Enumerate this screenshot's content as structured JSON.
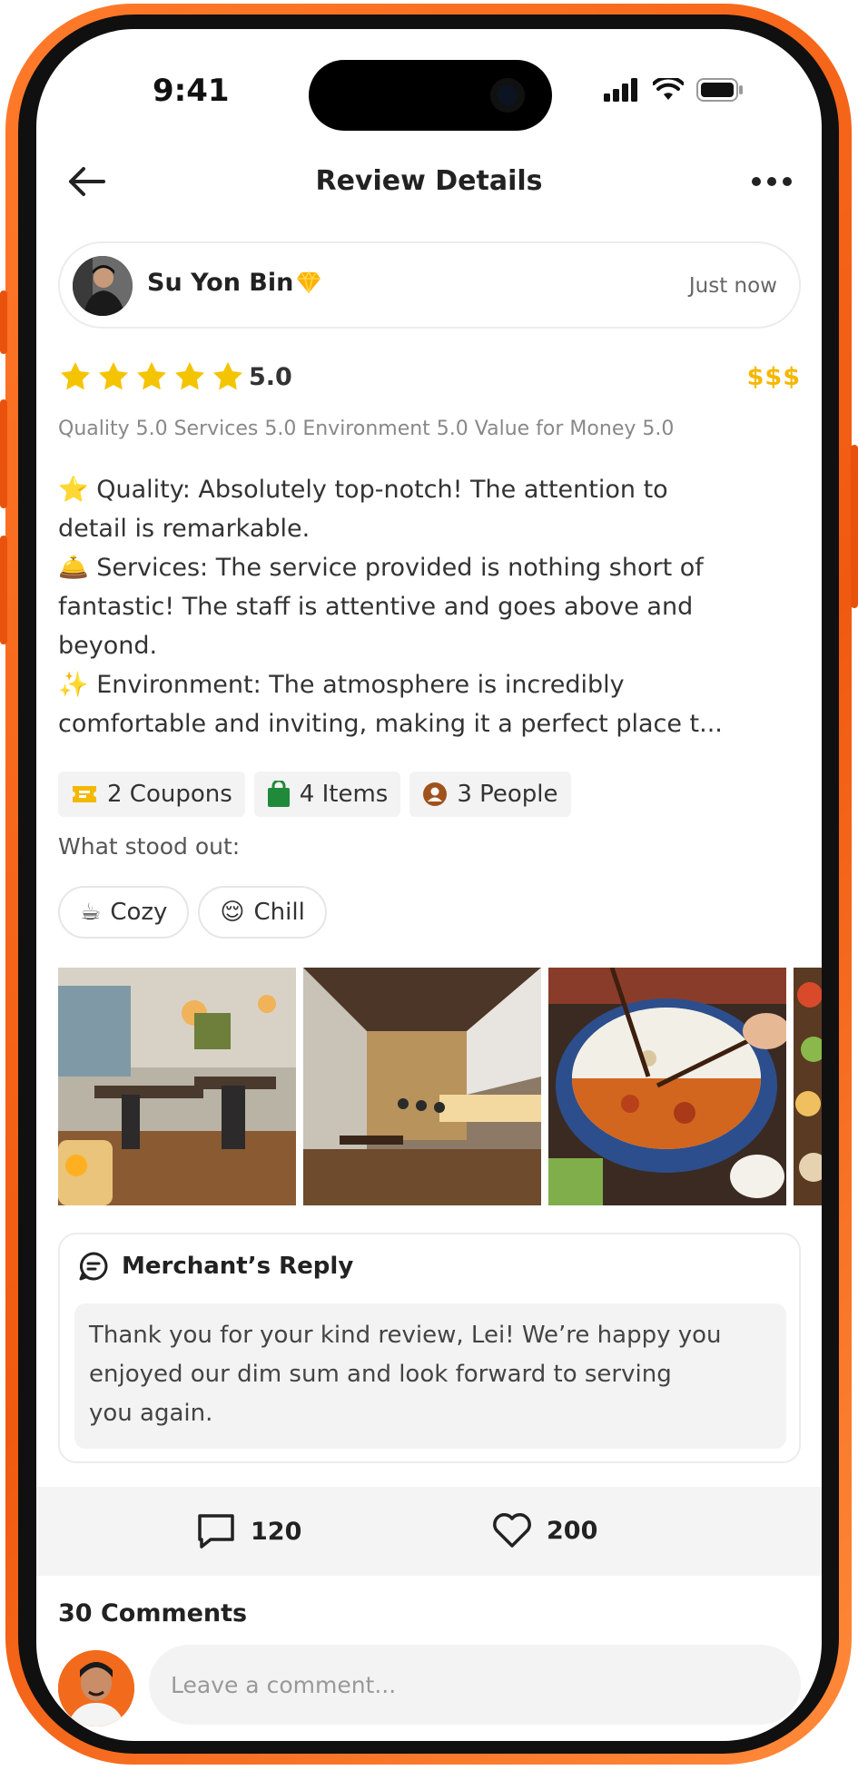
{
  "status_bar": {
    "time": "9:41"
  },
  "header": {
    "title": "Review Details"
  },
  "reviewer": {
    "name": "Su Yon Bin",
    "time_ago": "Just now"
  },
  "rating": {
    "stars": 5,
    "value": "5.0",
    "price_level": "$$$",
    "breakdown": "Quality 5.0 Services 5.0 Environment 5.0 Value for Money 5.0"
  },
  "review": {
    "lines": [
      {
        "emoji": "⭐",
        "text": " Quality: Absolutely top-notch! The attention to"
      },
      {
        "emoji": "",
        "text": "detail is remarkable."
      },
      {
        "emoji": "🛎️",
        "text": " Services: The service provided is nothing short of"
      },
      {
        "emoji": "",
        "text": "fantastic! The staff is attentive and goes above and"
      },
      {
        "emoji": "",
        "text": "beyond."
      },
      {
        "emoji": "✨",
        "text": " Environment: The atmosphere is incredibly"
      },
      {
        "emoji": "",
        "text": "comfortable and inviting, making it a perfect place t..."
      }
    ]
  },
  "chips": [
    {
      "label": "2 Coupons",
      "icon": "coupon-icon",
      "color": "#f5b800"
    },
    {
      "label": "4 Items",
      "icon": "shopping-bag-icon",
      "color": "#1f8a3a"
    },
    {
      "label": "3 People",
      "icon": "person-icon",
      "color": "#a0521c"
    }
  ],
  "stood_out": {
    "label": "What stood out:",
    "tags": [
      {
        "emoji": "☕",
        "label": "Cozy"
      },
      {
        "emoji": "😌",
        "label": "Chill"
      }
    ]
  },
  "merchant_reply": {
    "title": "Merchant’s Reply",
    "lines": [
      "Thank you for your kind review, Lei! We’re happy you",
      "enjoyed our dim sum and look forward to serving",
      "you again."
    ]
  },
  "actions": {
    "comments_count": "120",
    "likes_count": "200"
  },
  "comments": {
    "title": "30 Comments",
    "placeholder": "Leave a comment..."
  },
  "colors": {
    "frame": "#f05a10",
    "star": "#f5c400",
    "price": "#f5b800"
  }
}
